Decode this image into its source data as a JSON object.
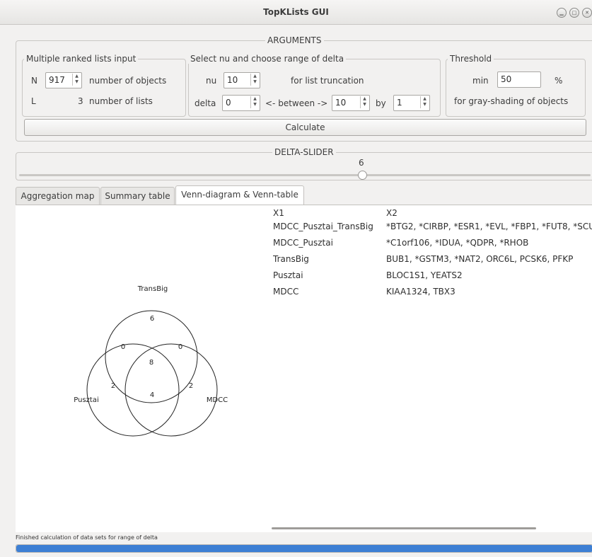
{
  "window": {
    "title": "TopKLists GUI"
  },
  "arguments": {
    "group_title": "ARGUMENTS",
    "input_group": {
      "title": "Multiple ranked lists input",
      "n_label": "N",
      "n_value": "917",
      "n_desc": "number of objects",
      "l_label": "L",
      "l_value": "3",
      "l_desc": "number of lists"
    },
    "nu_group": {
      "title": "Select nu and choose range of delta",
      "nu_label": "nu",
      "nu_value": "10",
      "nu_desc": "for list truncation",
      "delta_label": "delta",
      "delta_value": "0",
      "between_label": "<- between ->",
      "between_value": "10",
      "by_label": "by",
      "by_value": "1"
    },
    "threshold_group": {
      "title": "Threshold",
      "min_label": "min",
      "min_value": "50",
      "unit": "%",
      "desc": "for gray-shading of objects"
    },
    "calculate_label": "Calculate"
  },
  "delta_slider": {
    "title": "DELTA-SLIDER",
    "value": "6",
    "fraction": 0.6
  },
  "tabs": [
    {
      "label": "Aggregation map",
      "active": false
    },
    {
      "label": "Summary table",
      "active": false
    },
    {
      "label": "Venn-diagram & Venn-table",
      "active": true
    }
  ],
  "venn": {
    "sets": [
      "TransBig",
      "Pusztai",
      "MDCC"
    ],
    "regions": {
      "transbig_only": "6",
      "transbig_pusztai": "0",
      "transbig_mdcc": "0",
      "all": "8",
      "pusztai_only": "2",
      "mdcc_only": "2",
      "pusztai_mdcc": "4"
    }
  },
  "venn_table": {
    "headers": [
      "X1",
      "X2"
    ],
    "rows": [
      [
        "MDCC_Pusztai_TransBig",
        "*BTG2, *CIRBP, *ESR1, *EVL, *FBP1, *FUT8, *SCU"
      ],
      [
        "MDCC_Pusztai",
        "*C1orf106, *IDUA, *QDPR, *RHOB"
      ],
      [
        "TransBig",
        "BUB1, *GSTM3, *NAT2, ORC6L, PCSK6, PFKP"
      ],
      [
        "Pusztai",
        "BLOC1S1, YEATS2"
      ],
      [
        "MDCC",
        "KIAA1324, TBX3"
      ]
    ]
  },
  "status": {
    "text": "Finished calculation of data sets for range of delta",
    "progress": 1.0,
    "progress_color": "#3d7fd4"
  }
}
